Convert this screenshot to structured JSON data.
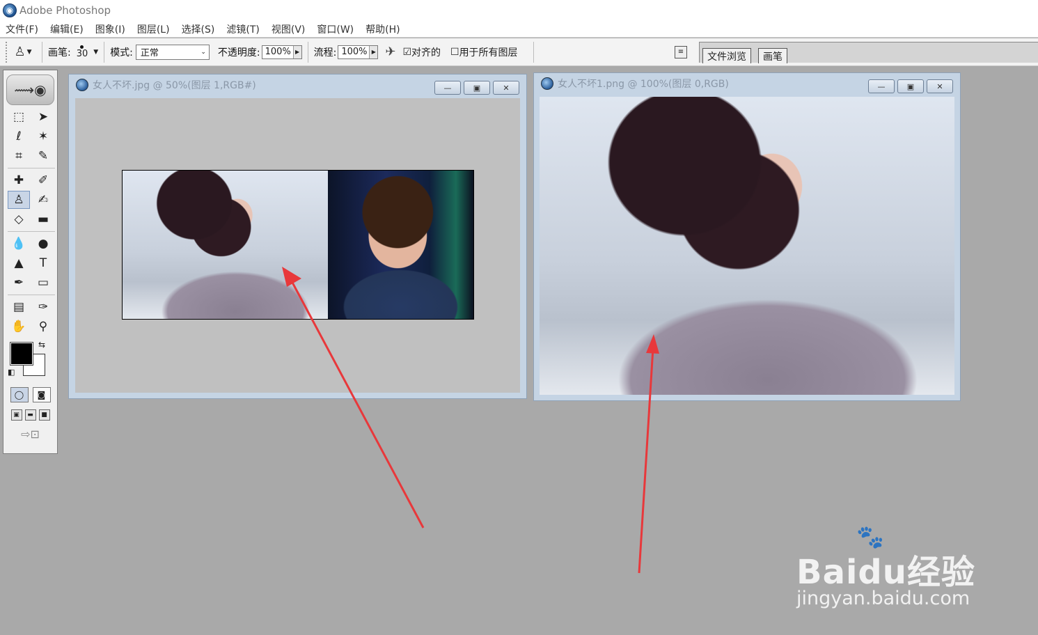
{
  "app": {
    "title": "Adobe Photoshop",
    "icon": "photoshop-eye-icon"
  },
  "menu": [
    "文件(F)",
    "编辑(E)",
    "图象(I)",
    "图层(L)",
    "选择(S)",
    "滤镜(T)",
    "视图(V)",
    "窗口(W)",
    "帮助(H)"
  ],
  "options": {
    "brush_label": "画笔:",
    "brush_size": "30",
    "mode_label": "模式:",
    "mode_value": "正常",
    "opacity_label": "不透明度:",
    "opacity_value": "100%",
    "flow_label": "流程:",
    "flow_value": "100%",
    "aligned_label": "对齐的",
    "aligned_checked": "☑",
    "all_layers_label": "用于所有图层",
    "all_layers_checked": "☐"
  },
  "palette_well": {
    "tabs": [
      "文件浏览",
      "画笔"
    ]
  },
  "toolbox": {
    "tools": [
      {
        "name": "marquee-tool-icon",
        "glyph": "⬚"
      },
      {
        "name": "move-tool-icon",
        "glyph": "➤"
      },
      {
        "name": "lasso-tool-icon",
        "glyph": "ℓ"
      },
      {
        "name": "magic-wand-tool-icon",
        "glyph": "✶"
      },
      {
        "name": "crop-tool-icon",
        "glyph": "⌗"
      },
      {
        "name": "slice-tool-icon",
        "glyph": "✎"
      },
      {
        "name": "healing-brush-tool-icon",
        "glyph": "✚"
      },
      {
        "name": "brush-tool-icon",
        "glyph": "✐"
      },
      {
        "name": "clone-stamp-tool-icon",
        "glyph": "♙",
        "active": true
      },
      {
        "name": "history-brush-tool-icon",
        "glyph": "✍"
      },
      {
        "name": "eraser-tool-icon",
        "glyph": "◇"
      },
      {
        "name": "gradient-tool-icon",
        "glyph": "▬"
      },
      {
        "name": "blur-tool-icon",
        "glyph": "💧"
      },
      {
        "name": "dodge-tool-icon",
        "glyph": "●"
      },
      {
        "name": "path-selection-tool-icon",
        "glyph": "▲"
      },
      {
        "name": "type-tool-icon",
        "glyph": "T"
      },
      {
        "name": "pen-tool-icon",
        "glyph": "✒"
      },
      {
        "name": "shape-tool-icon",
        "glyph": "▭"
      },
      {
        "name": "notes-tool-icon",
        "glyph": "▤"
      },
      {
        "name": "eyedropper-tool-icon",
        "glyph": "✑"
      },
      {
        "name": "hand-tool-icon",
        "glyph": "✋"
      },
      {
        "name": "zoom-tool-icon",
        "glyph": "⚲"
      }
    ],
    "foreground_color": "#000000",
    "background_color": "#ffffff"
  },
  "documents": [
    {
      "title": "女人不坏.jpg @ 50%(图层 1,RGB#)"
    },
    {
      "title": "女人不坏1.png @ 100%(图层 0,RGB)"
    }
  ],
  "annotation_color": "#e8383b",
  "watermark": {
    "brand": "Baidu经验",
    "url": "jingyan.baidu.com"
  }
}
